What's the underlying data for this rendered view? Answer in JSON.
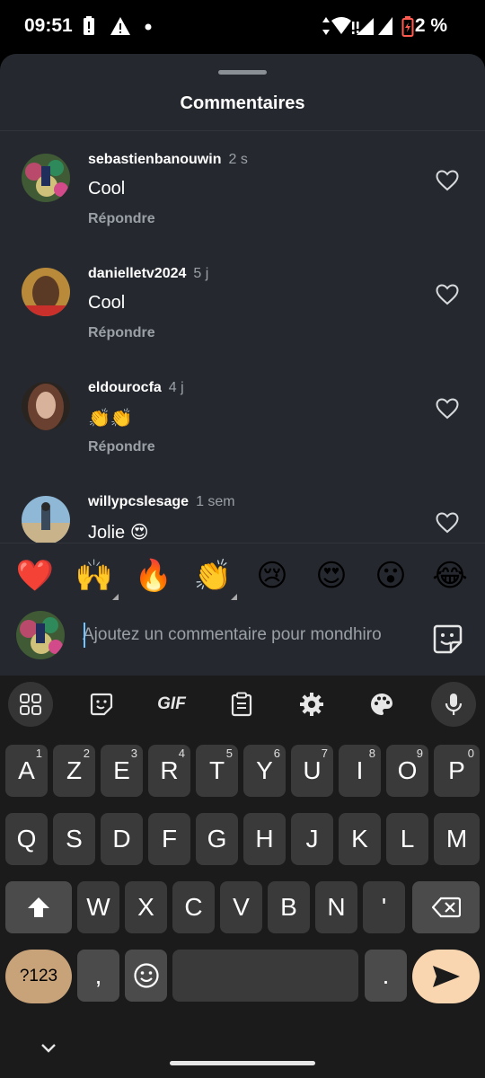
{
  "status_bar": {
    "time": "09:51",
    "battery": "2 %",
    "icons": [
      "battery-alert-icon",
      "warning-icon",
      "dot-icon",
      "data-arrows-icon",
      "wifi-alert-icon",
      "signal-icon",
      "battery-low-icon"
    ]
  },
  "sheet": {
    "title": "Commentaires"
  },
  "comments": [
    {
      "username": "sebastienbanouwin",
      "time": "2 s",
      "text": "Cool",
      "reply_label": "Répondre"
    },
    {
      "username": "danielletv2024",
      "time": "5 j",
      "text": "Cool",
      "reply_label": "Répondre"
    },
    {
      "username": "eldourocfa",
      "time": "4 j",
      "text": "👏👏",
      "reply_label": "Répondre"
    },
    {
      "username": "willypcslesage",
      "time": "1 sem",
      "text": "Jolie 😍",
      "reply_label": "Répondre"
    }
  ],
  "quick_emojis": [
    "❤️",
    "🙌",
    "🔥",
    "👏",
    "😢",
    "😍",
    "😮",
    "😂"
  ],
  "comment_input": {
    "placeholder": "Ajoutez un commentaire pour mondhiro"
  },
  "keyboard": {
    "toolbar": [
      "apps-grid-icon",
      "sticker-icon",
      "gif-icon",
      "clipboard-icon",
      "settings-icon",
      "palette-icon",
      "mic-icon"
    ],
    "gif_label": "GIF",
    "row1": [
      {
        "k": "A",
        "h": "1"
      },
      {
        "k": "Z",
        "h": "2"
      },
      {
        "k": "E",
        "h": "3"
      },
      {
        "k": "R",
        "h": "4"
      },
      {
        "k": "T",
        "h": "5"
      },
      {
        "k": "Y",
        "h": "6"
      },
      {
        "k": "U",
        "h": "7"
      },
      {
        "k": "I",
        "h": "8"
      },
      {
        "k": "O",
        "h": "9"
      },
      {
        "k": "P",
        "h": "0"
      }
    ],
    "row2": [
      "Q",
      "S",
      "D",
      "F",
      "G",
      "H",
      "J",
      "K",
      "L",
      "M"
    ],
    "row3": [
      "W",
      "X",
      "C",
      "V",
      "B",
      "N",
      "'"
    ],
    "symbols_label": "?123",
    "comma": ",",
    "period": "."
  }
}
